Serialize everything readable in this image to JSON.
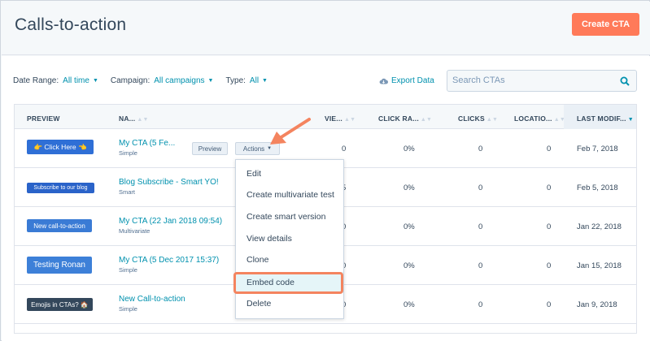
{
  "title": "Calls-to-action",
  "create_label": "Create CTA",
  "filters": {
    "date_label": "Date Range:",
    "date_value": "All time",
    "campaign_label": "Campaign:",
    "campaign_value": "All campaigns",
    "type_label": "Type:",
    "type_value": "All"
  },
  "export_label": "Export Data",
  "search_placeholder": "Search CTAs",
  "columns": {
    "preview": "PREVIEW",
    "name": "NA...",
    "views": "VIE...",
    "click_rate": "CLICK RA...",
    "clicks": "CLICKS",
    "locations": "LOCATIO...",
    "last_modified": "LAST MODIF..."
  },
  "rows": [
    {
      "preview_text": "👉 Click Here 👈",
      "preview_color": "#2f6fd6",
      "name": "My CTA (5 Fe...",
      "type": "Simple",
      "views": "0",
      "click_rate": "0%",
      "clicks": "0",
      "locations": "0",
      "modified": "Feb 7, 2018"
    },
    {
      "preview_text": "Subscribe to our blog",
      "preview_color": "#2a63c9",
      "name": "Blog Subscribe - Smart YO!",
      "type": "Smart",
      "views": "5",
      "click_rate": "0%",
      "clicks": "0",
      "locations": "0",
      "modified": "Feb 5, 2018"
    },
    {
      "preview_text": "New call-to-action",
      "preview_color": "#3a7bd5",
      "name": "My CTA (22 Jan 2018 09:54)",
      "type": "Multivariate",
      "views": "0",
      "click_rate": "0%",
      "clicks": "0",
      "locations": "0",
      "modified": "Jan 22, 2018"
    },
    {
      "preview_text": "Testing Ronan",
      "preview_color": "#3d80d8",
      "name": "My CTA (5 Dec 2017 15:37)",
      "type": "Simple",
      "views": "0",
      "click_rate": "0%",
      "clicks": "0",
      "locations": "0",
      "modified": "Jan 15, 2018"
    },
    {
      "preview_text": "Emojis in CTAs? 🏠",
      "preview_color": "#33475b",
      "name": "New Call-to-action",
      "type": "Simple",
      "views": "0",
      "click_rate": "0%",
      "clicks": "0",
      "locations": "0",
      "modified": "Jan 9, 2018"
    }
  ],
  "row_buttons": {
    "preview": "Preview",
    "actions": "Actions"
  },
  "menu": [
    "Edit",
    "Create multivariate test",
    "Create smart version",
    "View details",
    "Clone",
    "Embed code",
    "Delete"
  ],
  "colors": {
    "accent": "#ff7a59",
    "link": "#0091ae",
    "highlight_ring": "#f4845f"
  },
  "icons": {
    "export": "cloud-download-icon",
    "search": "search-icon",
    "sort": "sort-icon",
    "arrow": "annotation-arrow-icon"
  }
}
